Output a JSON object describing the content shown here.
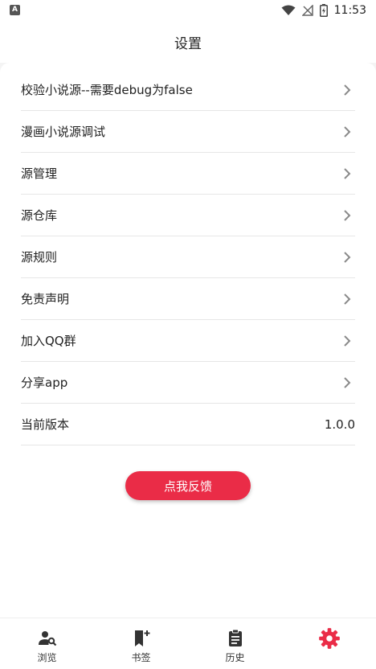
{
  "status": {
    "time": "11:53",
    "app_badge": "A"
  },
  "header": {
    "title": "设置"
  },
  "settings": {
    "items": [
      {
        "label": "校验小说源--需要debug为false"
      },
      {
        "label": "漫画小说源调试"
      },
      {
        "label": "源管理"
      },
      {
        "label": "源仓库"
      },
      {
        "label": "源规则"
      },
      {
        "label": "免责声明"
      },
      {
        "label": "加入QQ群"
      },
      {
        "label": "分享app"
      }
    ],
    "version_label": "当前版本",
    "version_value": "1.0.0"
  },
  "feedback": {
    "label": "点我反馈"
  },
  "nav": {
    "items": [
      {
        "label": "浏览",
        "icon": "person-search-icon"
      },
      {
        "label": "书签",
        "icon": "bookmark-add-icon"
      },
      {
        "label": "历史",
        "icon": "clipboard-icon"
      },
      {
        "label": "",
        "icon": "gear-icon"
      }
    ]
  },
  "colors": {
    "accent": "#ea2c47",
    "chevron": "#8a8a8a",
    "icon": "#333333"
  }
}
